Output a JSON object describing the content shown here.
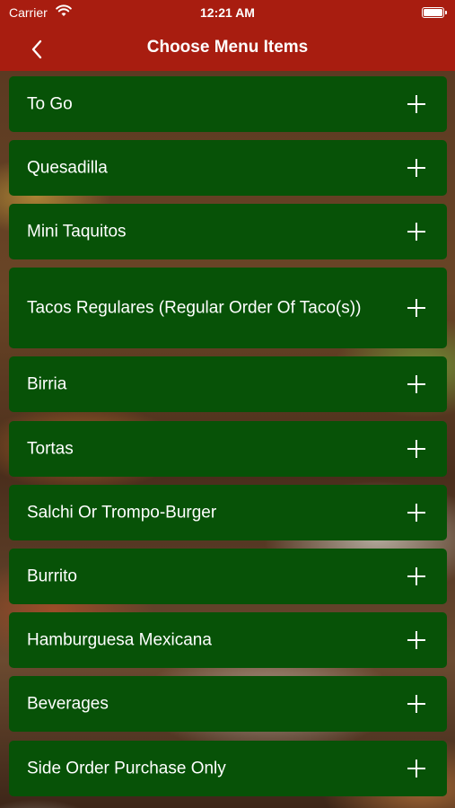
{
  "status_bar": {
    "carrier": "Carrier",
    "time": "12:21 AM",
    "wifi_icon": "wifi-icon",
    "battery_icon": "battery-icon"
  },
  "nav": {
    "title": "Choose Menu Items",
    "back_icon": "chevron-left-icon"
  },
  "colors": {
    "header_red": "#a81d10",
    "item_green": "#075207",
    "text_white": "#ffffff"
  },
  "menu_items": [
    {
      "label": "To Go",
      "icon": "plus-icon"
    },
    {
      "label": "Quesadilla",
      "icon": "plus-icon"
    },
    {
      "label": "Mini Taquitos",
      "icon": "plus-icon"
    },
    {
      "label": "Tacos Regulares (Regular Order Of Taco(s))",
      "icon": "plus-icon"
    },
    {
      "label": "Birria",
      "icon": "plus-icon"
    },
    {
      "label": "Tortas",
      "icon": "plus-icon"
    },
    {
      "label": "Salchi Or Trompo-Burger",
      "icon": "plus-icon"
    },
    {
      "label": "Burrito",
      "icon": "plus-icon"
    },
    {
      "label": "Hamburguesa Mexicana",
      "icon": "plus-icon"
    },
    {
      "label": "Beverages",
      "icon": "plus-icon"
    },
    {
      "label": "Side Order Purchase Only",
      "icon": "plus-icon"
    }
  ]
}
